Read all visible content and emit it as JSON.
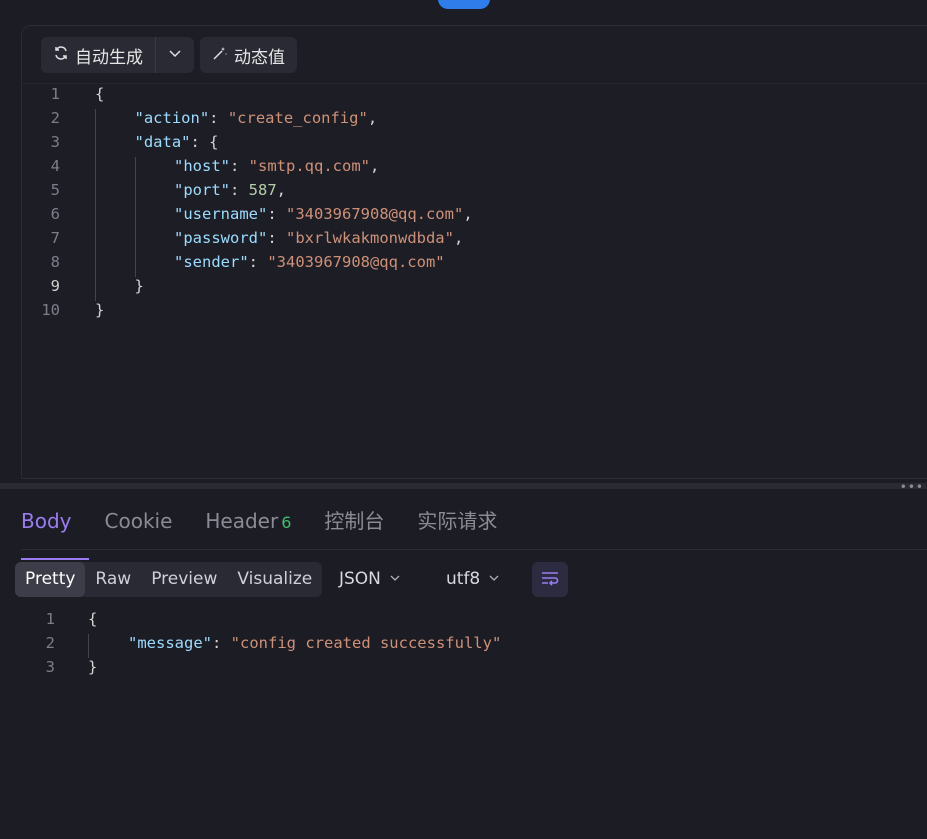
{
  "request": {
    "toolbar": {
      "auto_generate_label": "自动生成",
      "dynamic_value_label": "动态值"
    },
    "code_lines": [
      {
        "n": "1",
        "tokens": [
          {
            "t": "p",
            "v": "{"
          }
        ]
      },
      {
        "n": "2",
        "tokens": [
          {
            "t": "k",
            "v": "\"action\""
          },
          {
            "t": "p",
            "v": ": "
          },
          {
            "t": "s",
            "v": "\"create_config\""
          },
          {
            "t": "p",
            "v": ","
          }
        ]
      },
      {
        "n": "3",
        "tokens": [
          {
            "t": "k",
            "v": "\"data\""
          },
          {
            "t": "p",
            "v": ": {"
          }
        ]
      },
      {
        "n": "4",
        "tokens": [
          {
            "t": "k",
            "v": "\"host\""
          },
          {
            "t": "p",
            "v": ": "
          },
          {
            "t": "s",
            "v": "\"smtp.qq.com\""
          },
          {
            "t": "p",
            "v": ","
          }
        ]
      },
      {
        "n": "5",
        "tokens": [
          {
            "t": "k",
            "v": "\"port\""
          },
          {
            "t": "p",
            "v": ": "
          },
          {
            "t": "n",
            "v": "587"
          },
          {
            "t": "p",
            "v": ","
          }
        ]
      },
      {
        "n": "6",
        "tokens": [
          {
            "t": "k",
            "v": "\"username\""
          },
          {
            "t": "p",
            "v": ": "
          },
          {
            "t": "s",
            "v": "\"3403967908@qq.com\""
          },
          {
            "t": "p",
            "v": ","
          }
        ]
      },
      {
        "n": "7",
        "tokens": [
          {
            "t": "k",
            "v": "\"password\""
          },
          {
            "t": "p",
            "v": ": "
          },
          {
            "t": "s",
            "v": "\"bxrlwkakmonwdbda\""
          },
          {
            "t": "p",
            "v": ","
          }
        ]
      },
      {
        "n": "8",
        "tokens": [
          {
            "t": "k",
            "v": "\"sender\""
          },
          {
            "t": "p",
            "v": ": "
          },
          {
            "t": "s",
            "v": "\"3403967908@qq.com\""
          }
        ]
      },
      {
        "n": "9",
        "tokens": [
          {
            "t": "p",
            "v": "}"
          }
        ]
      },
      {
        "n": "10",
        "tokens": [
          {
            "t": "p",
            "v": "}"
          }
        ]
      }
    ],
    "active_line": "9"
  },
  "response": {
    "tabs": [
      {
        "label": "Body",
        "active": true
      },
      {
        "label": "Cookie"
      },
      {
        "label": "Header",
        "badge": "6"
      },
      {
        "label": "控制台"
      },
      {
        "label": "实际请求"
      }
    ],
    "view_modes": [
      "Pretty",
      "Raw",
      "Preview",
      "Visualize"
    ],
    "active_view": "Pretty",
    "format": "JSON",
    "encoding": "utf8",
    "code_lines": [
      {
        "n": "1",
        "tokens": [
          {
            "t": "p",
            "v": "{"
          }
        ]
      },
      {
        "n": "2",
        "tokens": [
          {
            "t": "k",
            "v": "\"message\""
          },
          {
            "t": "p",
            "v": ": "
          },
          {
            "t": "s",
            "v": "\"config created successfully\""
          }
        ]
      },
      {
        "n": "3",
        "tokens": [
          {
            "t": "p",
            "v": "}"
          }
        ]
      }
    ]
  },
  "colors": {
    "accent": "#9b7cf2",
    "key": "#9cdcfe",
    "string": "#ce9178",
    "number": "#b5cea8",
    "badge": "#3fbf6d"
  }
}
